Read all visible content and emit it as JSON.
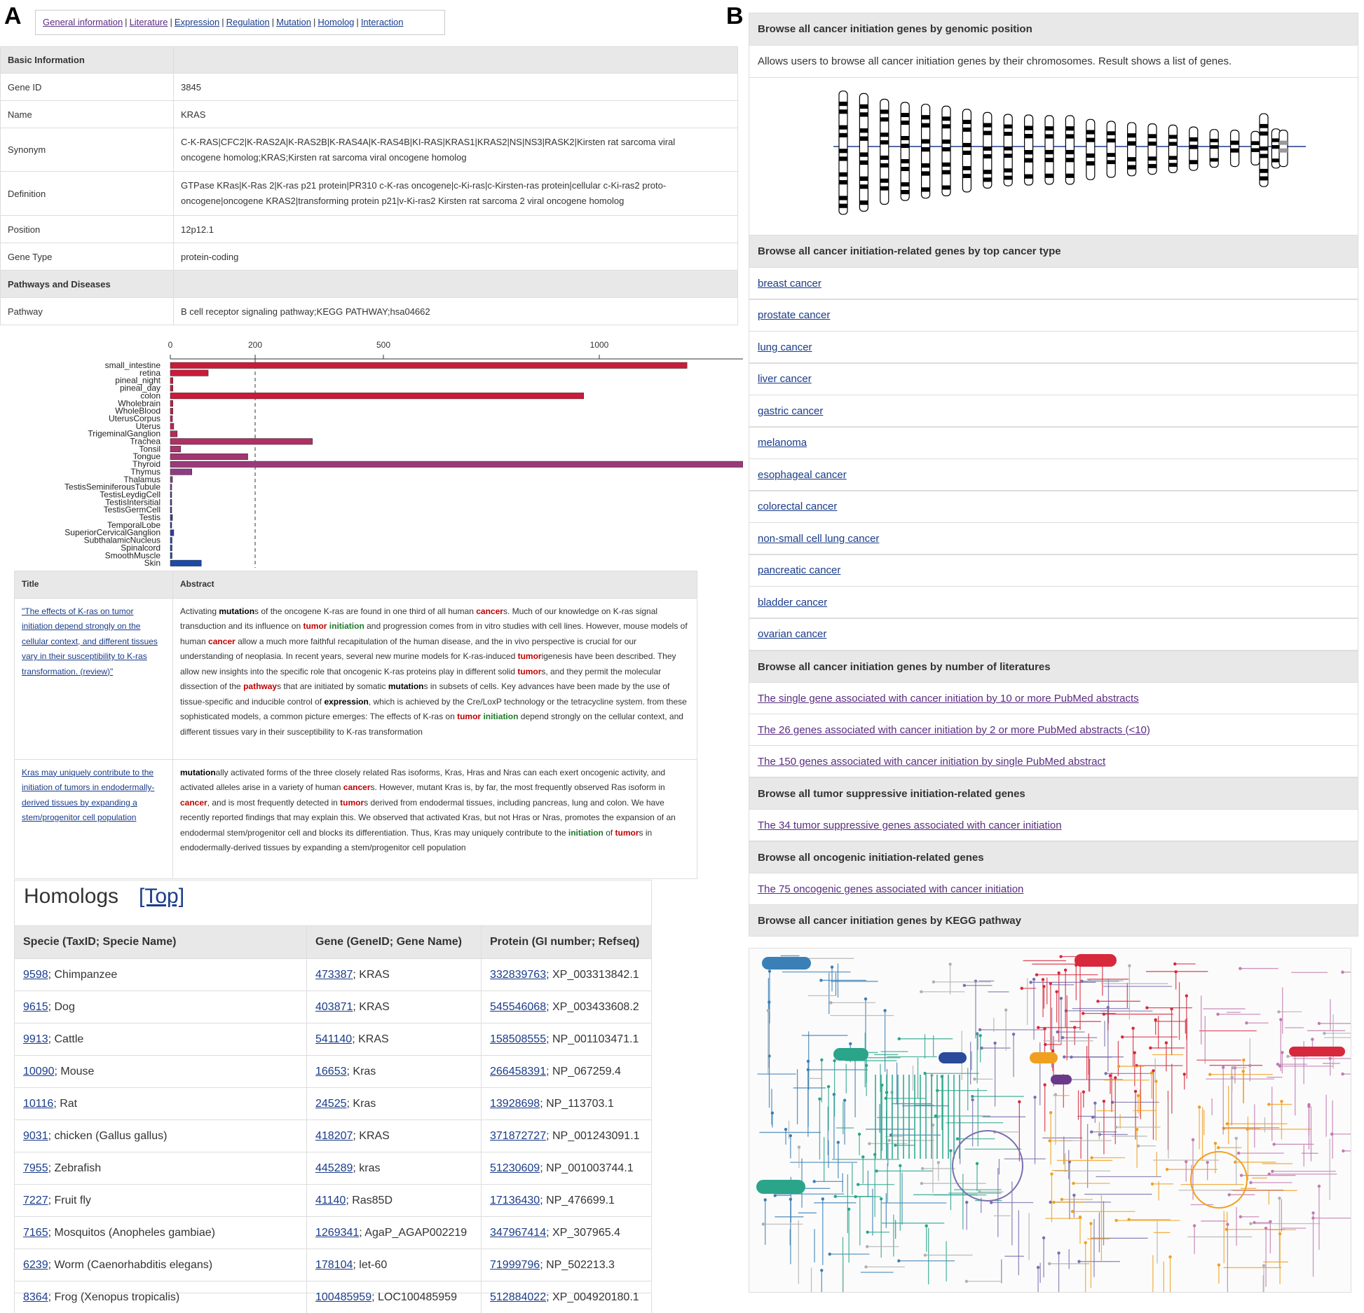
{
  "panel_labels": {
    "a": "A",
    "b": "B"
  },
  "nav": {
    "items": [
      "General information",
      "Literature",
      "Expression",
      "Regulation",
      "Mutation",
      "Homolog",
      "Interaction"
    ],
    "separator": "|"
  },
  "basic_info": {
    "header1": "Basic Information",
    "gene_id_label": "Gene ID",
    "gene_id": "3845",
    "name_label": "Name",
    "name": "KRAS",
    "synonym_label": "Synonym",
    "synonym_l1": "C-K-RAS|CFC2|K-RAS2A|K-RAS2B|K-RAS4A|K-RAS4B|KI-RAS|KRAS1|KRAS2|NS|NS3|RASK2|Kirsten rat sarcoma viral",
    "synonym_l2": "oncogene homolog;KRAS;Kirsten rat sarcoma viral oncogene homolog",
    "definition_label": "Definition",
    "definition_l1": "GTPase KRas|K-Ras 2|K-ras p21 protein|PR310 c-K-ras oncogene|c-Ki-ras|c-Kirsten-ras protein|cellular c-Ki-ras2 proto-",
    "definition_l2": "oncogene|oncogene KRAS2|transforming protein p21|v-Ki-ras2 Kirsten rat sarcoma 2 viral oncogene homolog",
    "position_label": "Position",
    "position": "12p12.1",
    "gene_type_label": "Gene Type",
    "gene_type": "protein-coding",
    "header2": "Pathways and Diseases",
    "pathway_label": "Pathway",
    "pathway": "B cell receptor signaling pathway;KEGG PATHWAY;hsa04662"
  },
  "chart_data": {
    "type": "bar",
    "orientation": "horizontal",
    "x_ticks": [
      "0",
      "200",
      "500",
      "1000"
    ],
    "reference_line": 200,
    "categories": [
      "small_intestine",
      "retina",
      "pineal_night",
      "pineal_day",
      "colon",
      "Wholebrain",
      "WholeBlood",
      "UterusCorpus",
      "Uterus",
      "TrigeminalGanglion",
      "Trachea",
      "Tonsil",
      "Tongue",
      "Thyroid",
      "Thymus",
      "Thalamus",
      "TestisSeminiferousTubule",
      "TestisLeydigCell",
      "TestisIntersitial",
      "TestisGermCell",
      "Testis",
      "TemporalLobe",
      "SuperiorCervicalGanglion",
      "SubthalamicNucleus",
      "Spinalcord",
      "SmoothMuscle",
      "Skin"
    ],
    "values": [
      1200,
      88,
      6,
      6,
      960,
      6,
      6,
      5,
      8,
      16,
      330,
      24,
      180,
      1330,
      50,
      5,
      3,
      3,
      3,
      3,
      5,
      3,
      8,
      4,
      4,
      4,
      72
    ],
    "colors": [
      "#cc1a3a",
      "#cc1a3a",
      "#cc1a3a",
      "#cc1a3a",
      "#cc1a3a",
      "#c51f45",
      "#c2214a",
      "#be2450",
      "#b92756",
      "#b42b5c",
      "#b03064",
      "#a9336b",
      "#a23671",
      "#9b3a7a",
      "#8f3c82",
      "#7f3c88",
      "#6d3b8c",
      "#5f3b90",
      "#523b92",
      "#473b95",
      "#3d3b98",
      "#353c9b",
      "#2d3e9e",
      "#2741a0",
      "#2243a2",
      "#1f46a4",
      "#1c4aa8"
    ],
    "grid": false
  },
  "literature": {
    "col_title": "Title",
    "col_abstract": "Abstract",
    "rows": [
      {
        "title": "\"The effects of K-ras on tumor initiation depend strongly on the cellular context, and different tissues vary in their susceptibility to K-ras transformation. (review)\"",
        "abstract": [
          {
            "t": "Activating "
          },
          {
            "t": "mutation",
            "c": "hl-black"
          },
          {
            "t": "s of the oncogene K-ras are found in one third of all human "
          },
          {
            "t": "cancer",
            "c": "hl-red"
          },
          {
            "t": "s. Much of our knowledge on K-ras signal transduction and its influence on "
          },
          {
            "t": "tumor",
            "c": "hl-red"
          },
          {
            "t": " "
          },
          {
            "t": "initiation",
            "c": "hl-green"
          },
          {
            "t": " and progression comes from in vitro studies with cell lines. However, mouse models of human "
          },
          {
            "t": "cancer",
            "c": "hl-red"
          },
          {
            "t": " allow a much more faithful recapitulation of the human disease, and the in vivo perspective is crucial for our understanding of neoplasia. In recent years, several new murine models for K-ras-induced "
          },
          {
            "t": "tumor",
            "c": "hl-red"
          },
          {
            "t": "igenesis have been described. They allow new insights into the specific role that oncogenic K-ras proteins play in different solid "
          },
          {
            "t": "tumor",
            "c": "hl-red"
          },
          {
            "t": "s, and they permit the molecular dissection of the "
          },
          {
            "t": "pathway",
            "c": "hl-red"
          },
          {
            "t": "s that are initiated by somatic "
          },
          {
            "t": "mutation",
            "c": "hl-black"
          },
          {
            "t": "s in subsets of cells. Key advances have been made by the use of tissue-specific and inducible control of "
          },
          {
            "t": "expression",
            "c": "hl-black"
          },
          {
            "t": ", which is achieved by the Cre/LoxP technology or the tetracycline system. from these sophisticated models, a common picture emerges: The effects of K-ras on "
          },
          {
            "t": "tumor",
            "c": "hl-red"
          },
          {
            "t": " "
          },
          {
            "t": "initiation",
            "c": "hl-green"
          },
          {
            "t": " depend strongly on the cellular context, and different tissues vary in their susceptibility to K-ras transformation"
          }
        ]
      },
      {
        "title": "Kras may uniquely contribute to the initiation of tumors in endodermally-derived tissues by expanding a stem/progenitor cell population",
        "abstract": [
          {
            "t": "mutation",
            "c": "hl-black"
          },
          {
            "t": "ally activated forms of the three closely related Ras isoforms, Kras, Hras and Nras can each exert oncogenic activity, and activated alleles arise in a variety of human "
          },
          {
            "t": "cancer",
            "c": "hl-red"
          },
          {
            "t": "s. However, mutant Kras is, by far, the most frequently observed Ras isoform in "
          },
          {
            "t": "cancer",
            "c": "hl-red"
          },
          {
            "t": ", and is most frequently detected in "
          },
          {
            "t": "tumor",
            "c": "hl-red"
          },
          {
            "t": "s derived from endodermal tissues, including pancreas, lung and colon. We have recently reported findings that may explain this. We observed that activated Kras, but not Hras or Nras, promotes the expansion of an endodermal stem/progenitor cell and blocks its differentiation. Thus, Kras may uniquely contribute to the "
          },
          {
            "t": "initiation",
            "c": "hl-green"
          },
          {
            "t": " of "
          },
          {
            "t": "tumor",
            "c": "hl-red"
          },
          {
            "t": "s in endodermally-derived tissues by expanding a stem/progenitor cell population"
          }
        ]
      }
    ]
  },
  "homologs": {
    "title": "Homologs",
    "top_link": "[Top]",
    "columns": [
      "Specie (TaxID; Specie Name)",
      "Gene (GeneID; Gene Name)",
      "Protein (GI number; Refseq)"
    ],
    "rows": [
      {
        "taxid": "9598",
        "species": "; Chimpanzee",
        "geneid": "473387",
        "gene": "; KRAS",
        "gi": "332839763",
        "refseq": "; XP_003313842.1"
      },
      {
        "taxid": "9615",
        "species": "; Dog",
        "geneid": "403871",
        "gene": "; KRAS",
        "gi": "545546068",
        "refseq": "; XP_003433608.2"
      },
      {
        "taxid": "9913",
        "species": "; Cattle",
        "geneid": "541140",
        "gene": "; KRAS",
        "gi": "158508555",
        "refseq": "; NP_001103471.1"
      },
      {
        "taxid": "10090",
        "species": "; Mouse",
        "geneid": "16653",
        "gene": "; Kras",
        "gi": "266458391",
        "refseq": "; NP_067259.4"
      },
      {
        "taxid": "10116",
        "species": "; Rat",
        "geneid": "24525",
        "gene": "; Kras",
        "gi": "13928698",
        "refseq": "; NP_113703.1"
      },
      {
        "taxid": "9031",
        "species": "; chicken (Gallus gallus)",
        "geneid": "418207",
        "gene": "; KRAS",
        "gi": "371872727",
        "refseq": "; NP_001243091.1"
      },
      {
        "taxid": "7955",
        "species": "; Zebrafish",
        "geneid": "445289",
        "gene": "; kras",
        "gi": "51230609",
        "refseq": "; NP_001003744.1"
      },
      {
        "taxid": "7227",
        "species": "; Fruit fly",
        "geneid": "41140",
        "gene": "; Ras85D",
        "gi": "17136430",
        "refseq": "; NP_476699.1"
      },
      {
        "taxid": "7165",
        "species": "; Mosquitos (Anopheles gambiae)",
        "geneid": "1269341",
        "gene": "; AgaP_AGAP002219",
        "gi": "347967414",
        "refseq": "; XP_307965.4"
      },
      {
        "taxid": "6239",
        "species": "; Worm (Caenorhabditis elegans)",
        "geneid": "178104",
        "gene": "; let-60",
        "gi": "71999796",
        "refseq": "; NP_502213.3"
      },
      {
        "taxid": "8364",
        "species": "; Frog (Xenopus tropicalis)",
        "geneid": "100485959",
        "gene": "; LOC100485959",
        "gi": "512884022",
        "refseq": "; XP_004920180.1"
      }
    ]
  },
  "browse": {
    "genomic_header": "Browse all cancer initiation genes by genomic position",
    "genomic_desc": "Allows users to browse all cancer initiation genes by their chromosomes. Result shows a list of genes.",
    "cancer_type_header": "Browse all cancer initiation-related genes by top cancer type",
    "cancer_types": [
      "breast cancer",
      "prostate cancer",
      "lung cancer",
      "liver cancer",
      "gastric cancer",
      "melanoma",
      "esophageal cancer",
      "colorectal cancer",
      "non-small cell lung cancer",
      "pancreatic cancer",
      "bladder cancer",
      "ovarian cancer"
    ],
    "literature_header": "Browse all cancer initiation genes by number of literatures",
    "literature_links": [
      "The single gene associated with cancer initiation by 10 or more PubMed abstracts",
      "The 26 genes associated with cancer initiation by 2 or more PubMed abstracts (<10)",
      "The 150 genes associated with cancer initiation by single PubMed abstract"
    ],
    "tumor_header": "Browse all tumor suppressive initiation-related genes",
    "tumor_link": "The 34 tumor suppressive genes associated with cancer initiation",
    "onco_header": "Browse all oncogenic initiation-related genes",
    "onco_link": "The 75 oncogenic genes associated with cancer initiation",
    "kegg_header": "Browse all cancer initiation genes by KEGG pathway"
  },
  "colors": {
    "link": "#1a3c8a",
    "header_bg": "#e8e8e8",
    "red": "#c00000",
    "green": "#1f7a2a",
    "kegg_teal": "#2a8a9a",
    "kegg_orange": "#f0a020",
    "kegg_red": "#d8283c"
  }
}
